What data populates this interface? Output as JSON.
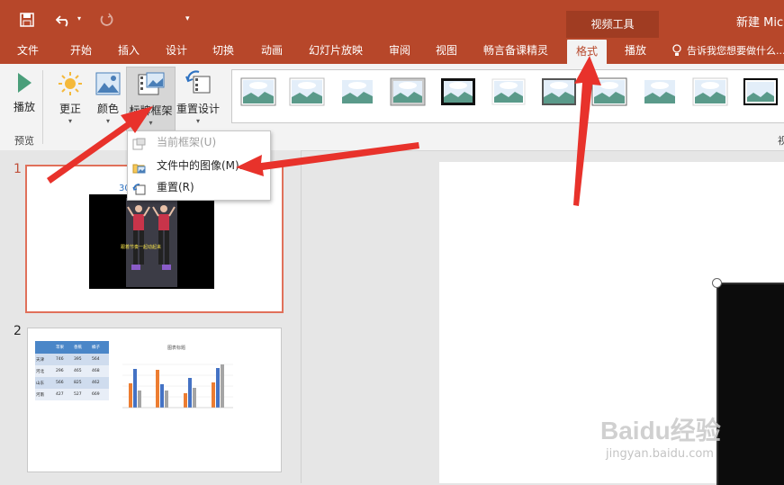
{
  "title_bar": {
    "video_tools": "视频工具",
    "document_title": "新建 Micr",
    "save_icon": "save-icon",
    "undo_icon": "undo-icon",
    "redo_icon": "redo-icon",
    "customize_icon": "customize-icon"
  },
  "tabs": [
    {
      "label": "文件"
    },
    {
      "label": "开始"
    },
    {
      "label": "插入"
    },
    {
      "label": "设计"
    },
    {
      "label": "切换"
    },
    {
      "label": "动画"
    },
    {
      "label": "幻灯片放映"
    },
    {
      "label": "审阅"
    },
    {
      "label": "视图"
    },
    {
      "label": "畅言备课精灵"
    },
    {
      "label": "格式",
      "active": true
    },
    {
      "label": "播放"
    }
  ],
  "tell_me": "告诉我您想要做什么...",
  "ribbon": {
    "play": "播放",
    "corrections": "更正",
    "color": "颜色",
    "poster_frame": "标牌框架",
    "reset_design": "重置设计",
    "preview_group": "预览",
    "right_group_partial": "视"
  },
  "dropdown": {
    "items": [
      {
        "label": "当前框架(U)",
        "enabled": false
      },
      {
        "label": "文件中的图像(M)...",
        "enabled": true
      },
      {
        "label": "重置(R)",
        "enabled": true
      }
    ]
  },
  "slides": [
    {
      "number": "1",
      "title_partial": "30",
      "caption": "跟着节奏一起动起来"
    },
    {
      "number": "2",
      "chart_title": "图表标题"
    }
  ],
  "slide2_table": {
    "headers": [
      "",
      "苹果",
      "香蕉",
      "橘子"
    ],
    "rows": [
      [
        "天津",
        "746",
        "395",
        "564"
      ],
      [
        "河北",
        "296",
        "465",
        "468"
      ],
      [
        "山东",
        "566",
        "825",
        "462"
      ],
      [
        "河南",
        "427",
        "527",
        "669"
      ]
    ]
  },
  "watermark": {
    "brand": "Baidu经验",
    "url": "jingyan.baidu.com"
  },
  "colors": {
    "accent": "#b7472a",
    "format_tab_text": "#b7472a",
    "arrow": "#e8322b"
  }
}
